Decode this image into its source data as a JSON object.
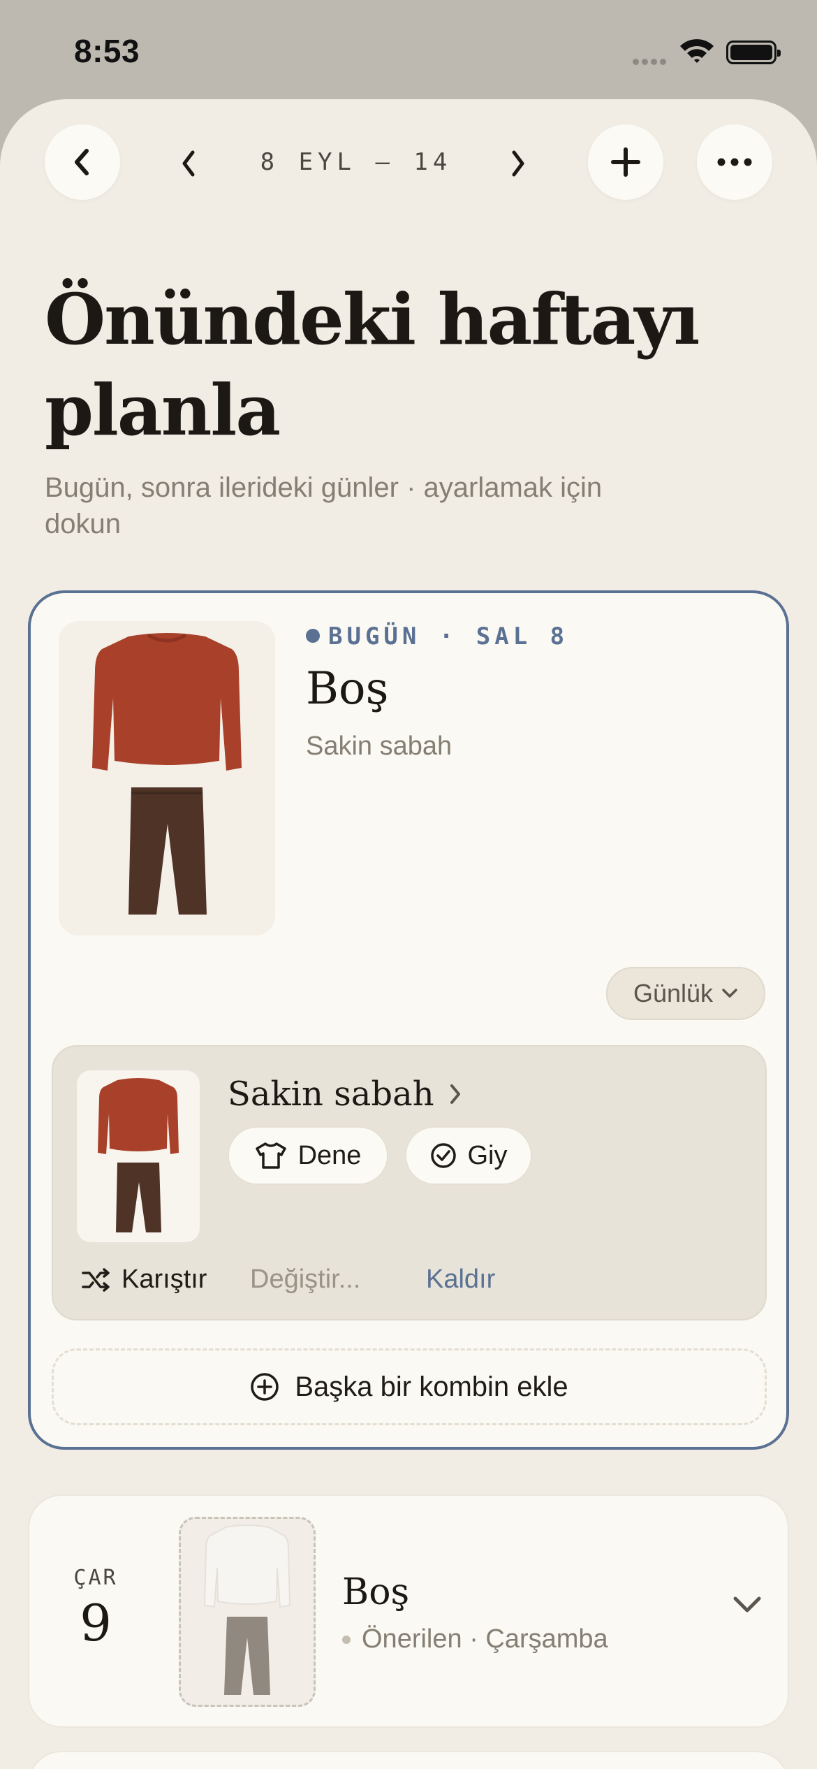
{
  "status_bar": {
    "time": "8:53"
  },
  "header": {
    "week_range": "8 EYL — 14"
  },
  "page": {
    "title": "Önündeki haftayı planla",
    "subtitle": "Bugün, sonra ilerideki günler · ayarlamak için dokun"
  },
  "today": {
    "label": "BUGÜN · SAL 8",
    "title": "Boş",
    "subtitle": "Sakin sabah",
    "occasion": "Günlük",
    "outfit": {
      "name": "Sakin sabah",
      "try_label": "Dene",
      "wear_label": "Giy",
      "shuffle_label": "Karıştır",
      "change_label": "Değiştir...",
      "remove_label": "Kaldır"
    },
    "add_outfit_label": "Başka bir kombin ekle"
  },
  "days": [
    {
      "abbr": "ÇAR",
      "num": "9",
      "title": "Boş",
      "subtitle": "Önerilen · Çarşamba"
    }
  ],
  "colors": {
    "accent": "#5a7193",
    "sheet_bg": "#f1ede4",
    "card_bg": "#fbf9f3",
    "sweater": "#a8402a",
    "trousers": "#4e3326",
    "muted_text": "#857e73"
  }
}
